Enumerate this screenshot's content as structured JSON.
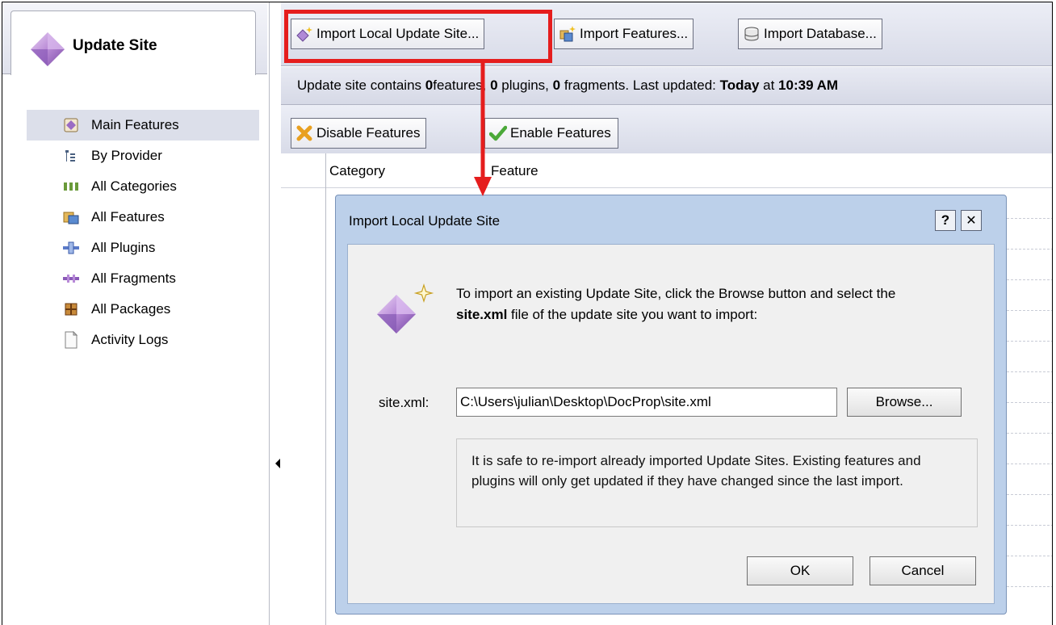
{
  "sidebar": {
    "title": "Update Site",
    "items": [
      {
        "label": "Main Features",
        "icon": "main-features-icon",
        "selected": true
      },
      {
        "label": "By Provider",
        "icon": "tree-icon",
        "selected": false
      },
      {
        "label": "All Categories",
        "icon": "categories-icon",
        "selected": false
      },
      {
        "label": "All Features",
        "icon": "features-icon",
        "selected": false
      },
      {
        "label": "All Plugins",
        "icon": "plugin-icon",
        "selected": false
      },
      {
        "label": "All Fragments",
        "icon": "fragment-icon",
        "selected": false
      },
      {
        "label": "All Packages",
        "icon": "package-icon",
        "selected": false
      },
      {
        "label": "Activity Logs",
        "icon": "document-icon",
        "selected": false
      }
    ]
  },
  "toolbar": {
    "import_local": "Import Local Update Site...",
    "import_features": "Import Features...",
    "import_database": "Import Database..."
  },
  "infobar": {
    "prefix": "Update site contains ",
    "features_count": "0",
    "features_suffix": "features, ",
    "plugins_count": "0",
    "plugins_suffix": " plugins, ",
    "fragments_count": "0",
    "fragments_suffix": " fragments. Last updated: ",
    "updated_day": "Today",
    "updated_mid": " at ",
    "updated_time": "10:39 AM"
  },
  "actions": {
    "disable": "Disable Features",
    "enable": "Enable Features"
  },
  "table": {
    "columns": [
      "Category",
      "Feature"
    ]
  },
  "dialog": {
    "title": "Import Local Update Site",
    "help": "?",
    "close": "✕",
    "msg_part1": "To import an existing Update Site, click the Browse button and select the ",
    "msg_bold": "site.xml",
    "msg_part2": " file of the update site you want to import:",
    "field_label": "site.xml:",
    "field_value": "C:\\Users\\julian\\Desktop\\DocProp\\site.xml",
    "browse": "Browse...",
    "note": "It is safe to re-import already imported Update Sites. Existing features and plugins will only get updated if they have changed since the last import.",
    "ok": "OK",
    "cancel": "Cancel"
  },
  "colors": {
    "highlight": "#e51d1d",
    "dialog_frame": "#bcd0ea",
    "selection": "#dcdfea"
  }
}
